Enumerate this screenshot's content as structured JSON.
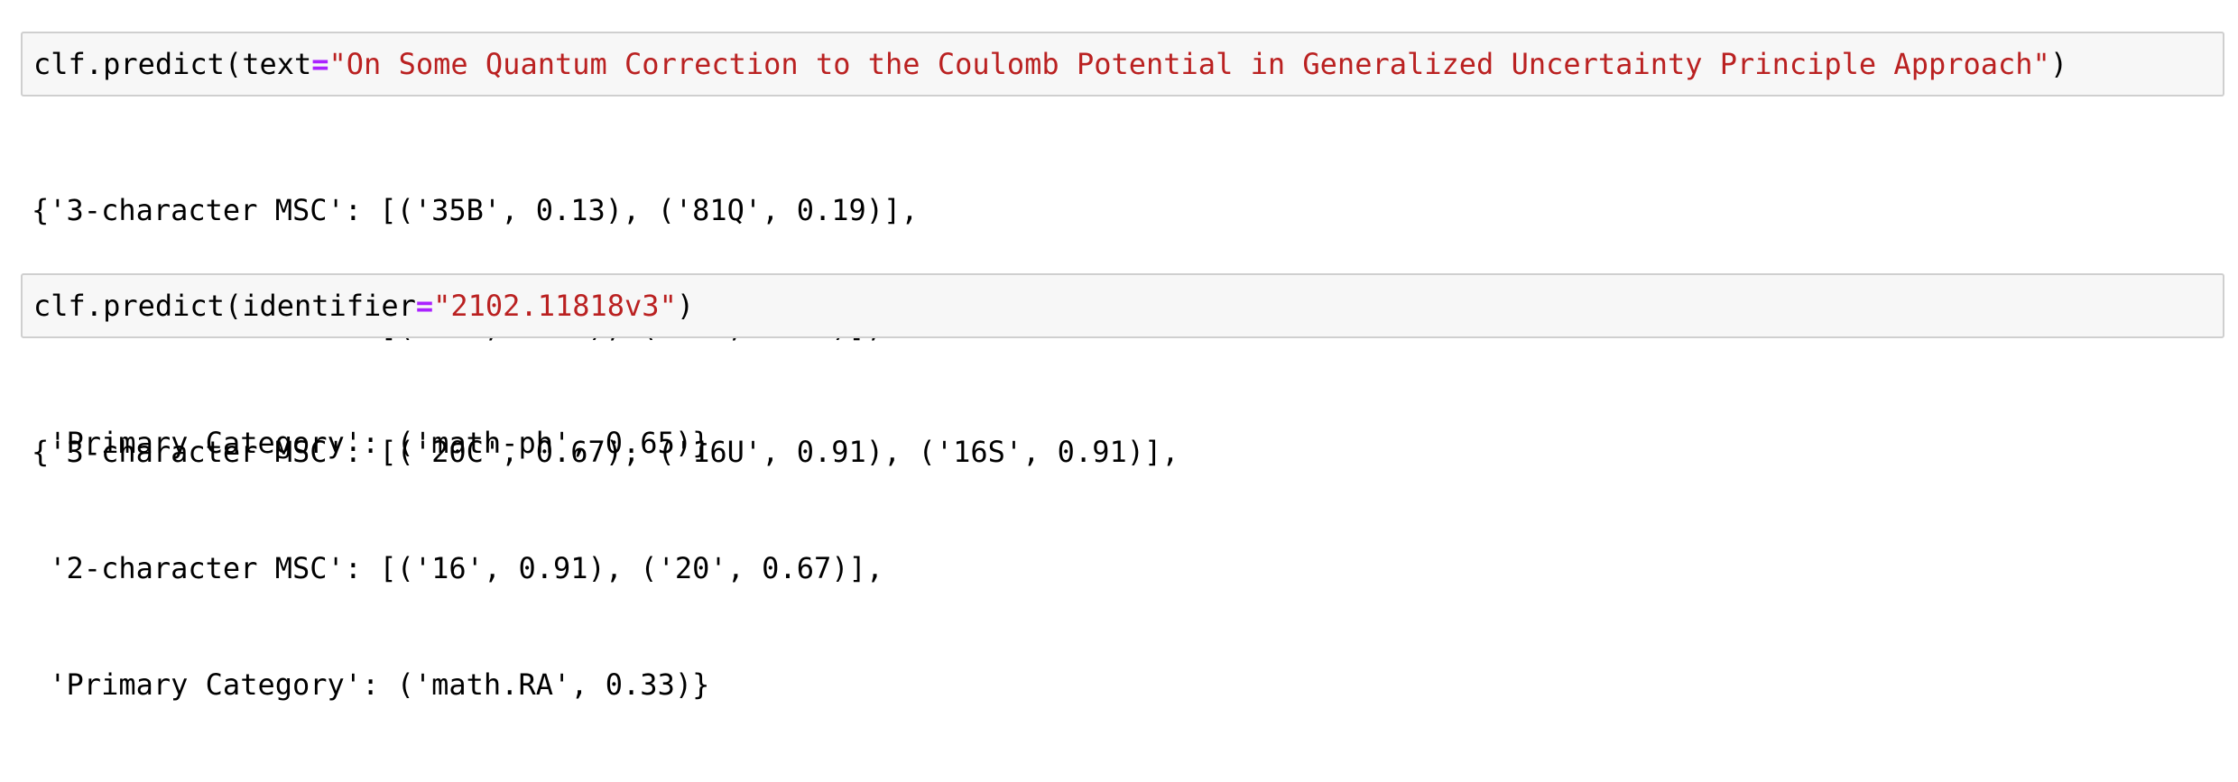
{
  "cells": [
    {
      "input": {
        "fn": "clf.predict(",
        "kw": "text",
        "op": "=",
        "str": "\"On Some Quantum Correction to the Coulomb Potential in Generalized Uncertainty Principle Approach\"",
        "close": ")"
      },
      "output": [
        "{'3-character MSC': [('35B', 0.13), ('81Q', 0.19)],",
        " '2-character MSC': [('35', 0.13), ('81', 0.19)],",
        " 'Primary Category': ('math-ph', 0.65)}"
      ]
    },
    {
      "input": {
        "fn": "clf.predict(",
        "kw": "identifier",
        "op": "=",
        "str": "\"2102.11818v3\"",
        "close": ")"
      },
      "output": [
        "{'3-character MSC': [('20C', 0.67), ('16U', 0.91), ('16S', 0.91)],",
        " '2-character MSC': [('16', 0.91), ('20', 0.67)],",
        " 'Primary Category': ('math.RA', 0.33)}"
      ]
    }
  ],
  "colors": {
    "string": "#ba2121",
    "operator": "#aa22ff",
    "cell_background": "#f7f7f7",
    "cell_border": "#cfcfcf"
  }
}
